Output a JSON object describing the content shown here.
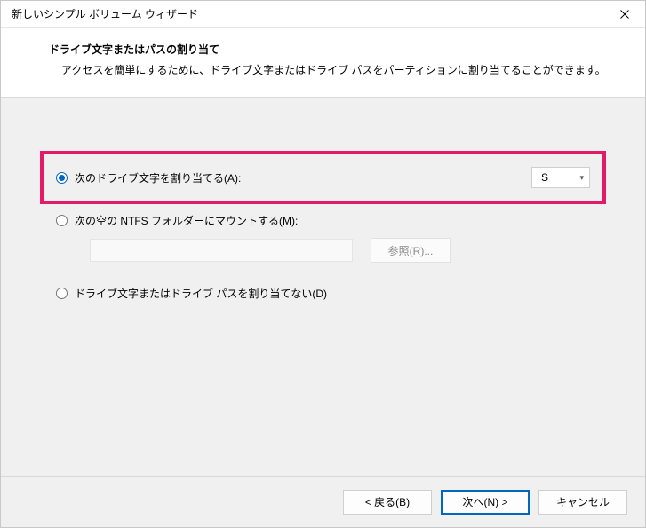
{
  "window": {
    "title": "新しいシンプル ボリューム ウィザード"
  },
  "header": {
    "title": "ドライブ文字またはパスの割り当て",
    "desc": "アクセスを簡単にするために、ドライブ文字またはドライブ パスをパーティションに割り当てることができます。"
  },
  "options": {
    "assign_letter": {
      "label": "次のドライブ文字を割り当てる(A):",
      "selected_value": "S"
    },
    "mount_ntfs": {
      "label": "次の空の NTFS フォルダーにマウントする(M):",
      "path_value": "",
      "browse_label": "参照(R)..."
    },
    "no_assign": {
      "label": "ドライブ文字またはドライブ パスを割り当てない(D)"
    }
  },
  "footer": {
    "back": "< 戻る(B)",
    "next": "次へ(N) >",
    "cancel": "キャンセル"
  }
}
